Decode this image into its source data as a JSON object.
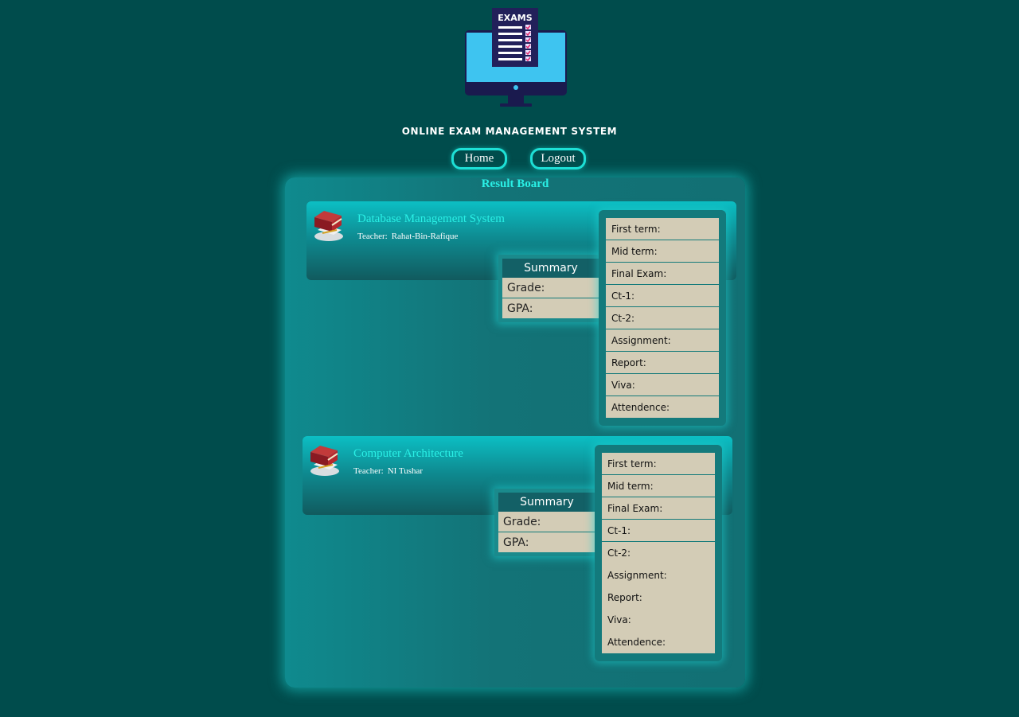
{
  "header": {
    "logo_text": "EXAMS",
    "app_title": "ONLINE EXAM MANAGEMENT SYSTEM"
  },
  "nav": {
    "home_label": "Home",
    "logout_label": "Logout"
  },
  "board": {
    "title": "Result Board",
    "courses": [
      {
        "name": "Database Management System",
        "teacher_label": "Teacher:",
        "teacher_name": "Rahat-Bin-Rafique",
        "summary": {
          "title": "Summary",
          "grade_label": "Grade:",
          "gpa_label": "GPA:"
        },
        "marks": [
          "First term:",
          "Mid term:",
          "Final Exam:",
          "Ct-1:",
          "Ct-2:",
          "Assignment:",
          "Report:",
          "Viva:",
          "Attendence:"
        ]
      },
      {
        "name": "Computer Architecture",
        "teacher_label": "Teacher:",
        "teacher_name": "NI Tushar",
        "summary": {
          "title": "Summary",
          "grade_label": "Grade:",
          "gpa_label": "GPA:"
        },
        "marks": [
          "First term:",
          "Mid term:",
          "Final Exam:",
          "Ct-1:",
          "Ct-2:",
          "Assignment:",
          "Report:",
          "Viva:",
          "Attendence:"
        ]
      }
    ]
  },
  "colors": {
    "page_bg": "#004c4c",
    "accent": "#2af0e6",
    "panel_bg": "#d3ccb6"
  }
}
